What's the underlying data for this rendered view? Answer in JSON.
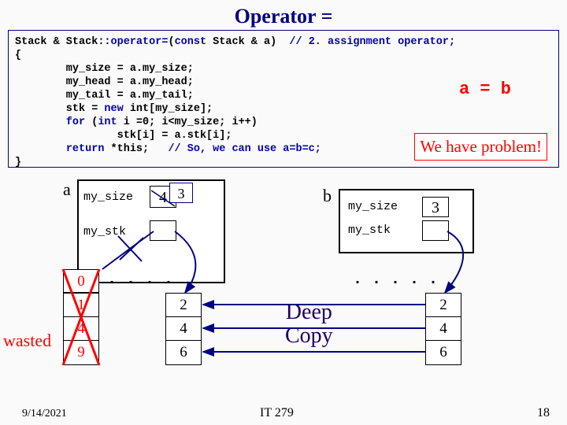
{
  "title": "Operator =",
  "code": {
    "sig_pre": "Stack & Stack::",
    "sig_op": "operator=",
    "sig_post": "(",
    "sig_const": "const",
    "sig_post2": " Stack & a)  ",
    "sig_cmt": "// 2. assignment operator;",
    "brace_open": "{",
    "l1": "        my_size = a.my_size;",
    "l2": "        my_head = a.my_head;",
    "l3": "        my_tail = a.my_tail;",
    "l4a": "        stk = ",
    "l4_new": "new",
    "l4b": " int[my_size];",
    "l5a": "        ",
    "l5_for": "for",
    "l5b": " (",
    "l5_int": "int",
    "l5c": " i =0; i<my_size; i++)",
    "l6": "                stk[i] = a.stk[i];",
    "l7a": "        ",
    "l7_ret": "return",
    "l7b": " *this;   ",
    "l7_cmt": "// So, we can use a=b=c;",
    "brace_close": "}"
  },
  "annot_ab": "a = b",
  "problem": "We have problem!",
  "obj_a": {
    "label": "a",
    "size_field": "my_size",
    "stk_field": "my_stk",
    "size_old": "4",
    "size_new": "3"
  },
  "obj_b": {
    "label": "b",
    "size_field": "my_size",
    "stk_field": "my_stk",
    "size": "3"
  },
  "arr_a_old_top": "0",
  "arr_a_old": [
    "1",
    "4",
    "9"
  ],
  "arr_a_new": [
    "2",
    "4",
    "6"
  ],
  "arr_b": [
    "2",
    "4",
    "6"
  ],
  "dots": ". . . .",
  "dots2": ". . . . .",
  "wasted": "wasted",
  "deep": "Deep\nCopy",
  "footer": {
    "date": "9/14/2021",
    "course": "IT 279",
    "page": "18"
  }
}
